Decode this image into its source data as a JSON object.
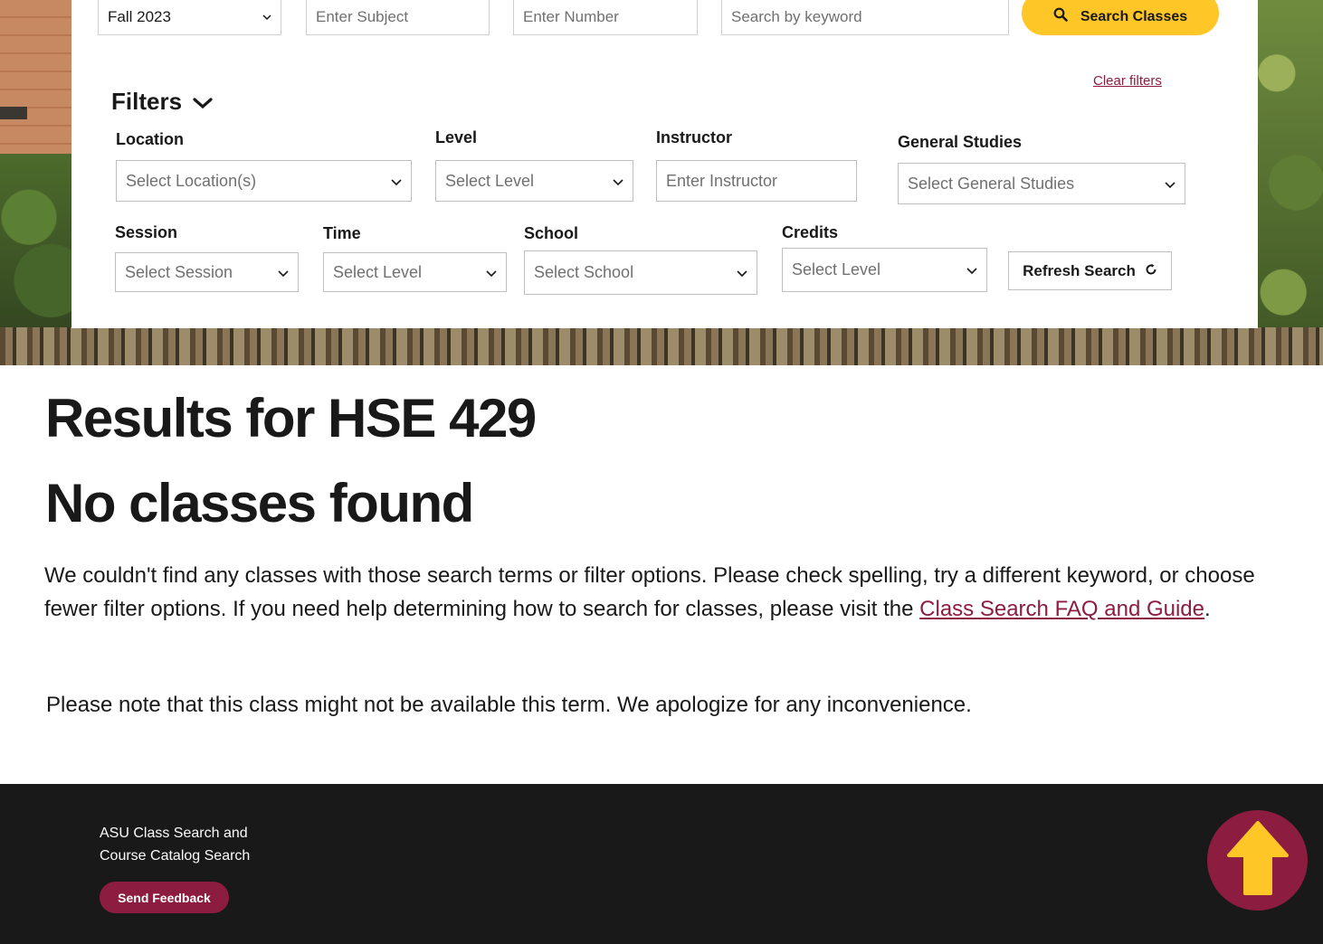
{
  "search_bar": {
    "term_value": "Fall 2023",
    "subject_placeholder": "Enter Subject",
    "number_placeholder": "Enter Number",
    "keyword_placeholder": "Search by keyword",
    "search_button_label": "Search Classes",
    "search_icon": "search-icon"
  },
  "filters": {
    "title": "Filters",
    "clear_label": "Clear filters",
    "location": {
      "label": "Location",
      "value": "Select Location(s)"
    },
    "level": {
      "label": "Level",
      "value": "Select Level"
    },
    "instructor": {
      "label": "Instructor",
      "placeholder": "Enter Instructor"
    },
    "general_studies": {
      "label": "General Studies",
      "value": "Select General Studies"
    },
    "session": {
      "label": "Session",
      "value": "Select Session"
    },
    "time": {
      "label": "Time",
      "value": "Select Level"
    },
    "school": {
      "label": "School",
      "value": "Select School"
    },
    "credits": {
      "label": "Credits",
      "value": "Select Level"
    },
    "refresh_label": "Refresh Search",
    "refresh_icon": "refresh-icon"
  },
  "results": {
    "title": "Results for HSE 429",
    "no_classes": "No classes found",
    "message_prefix": "We couldn't find any classes with those search terms or filter options. Please check spelling, try a different keyword, or choose fewer filter options. If you need help determining how to search for classes, please visit the ",
    "faq_link": "Class Search FAQ and Guide",
    "message_suffix": ".",
    "note": "Please note that this class might not be available this term. We apologize for any inconvenience."
  },
  "footer": {
    "title_line1": "ASU Class Search and",
    "title_line2": "Course Catalog Search",
    "feedback_label": "Send Feedback",
    "back_to_top_icon": "arrow-up-icon"
  },
  "colors": {
    "maroon": "#8c1d40",
    "gold": "#ffc627",
    "footer_bg": "#191919"
  }
}
